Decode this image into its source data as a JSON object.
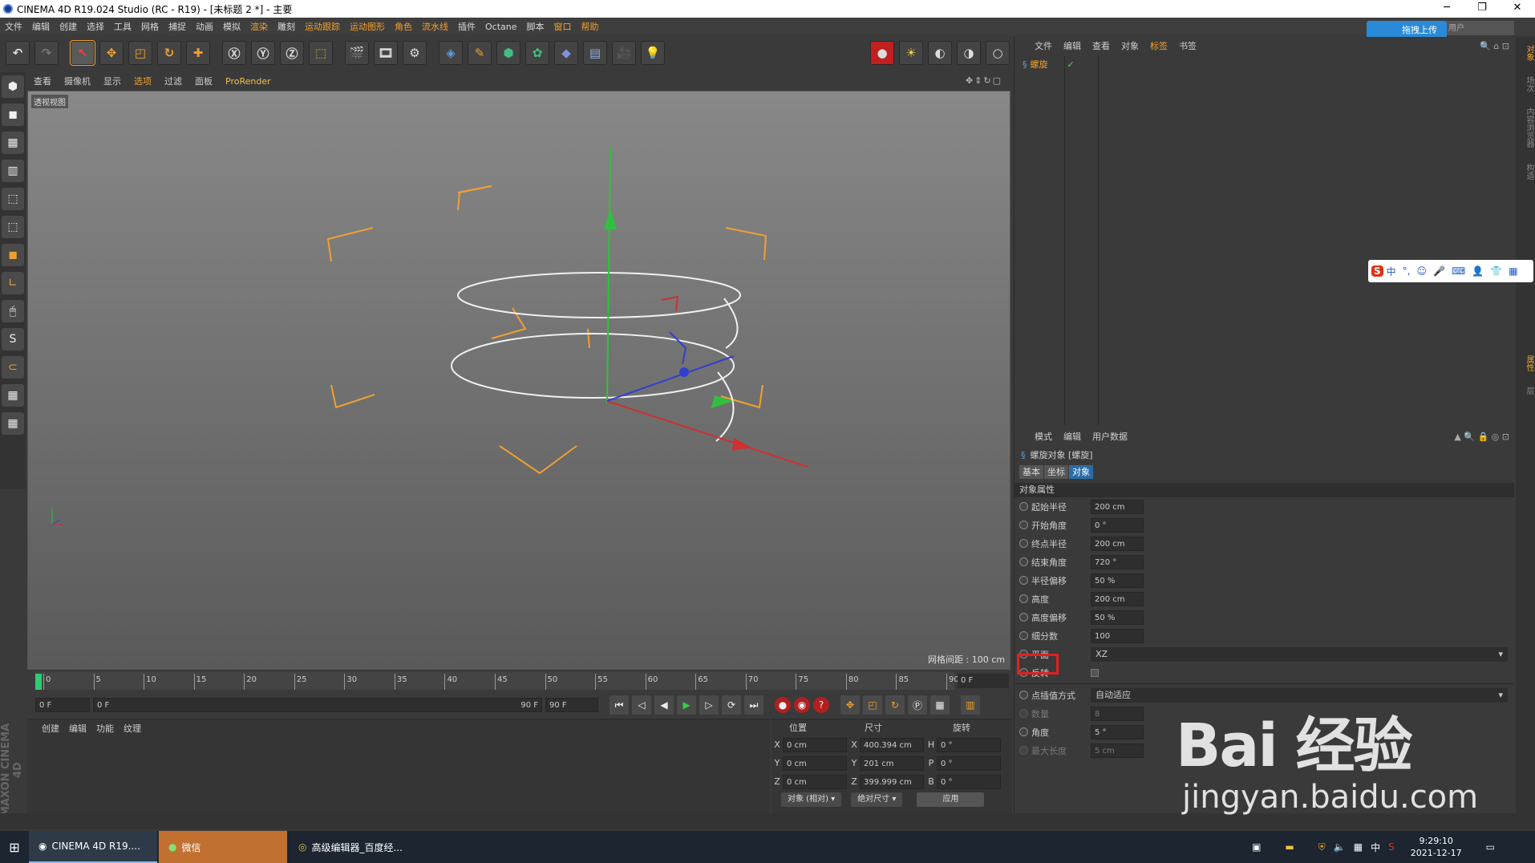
{
  "window": {
    "title": "CINEMA 4D R19.024 Studio (RC - R19) - [未标题 2 *] - 主要"
  },
  "menu": [
    "文件",
    "编辑",
    "创建",
    "选择",
    "工具",
    "网格",
    "捕捉",
    "动画",
    "模拟",
    "渲染",
    "雕刻",
    "运动跟踪",
    "运动图形",
    "角色",
    "流水线",
    "插件",
    "Octane",
    "脚本",
    "窗口",
    "帮助"
  ],
  "upload": "拖拽上传",
  "user": "用户",
  "viewport": {
    "menu": [
      "查看",
      "摄像机",
      "显示",
      "选项",
      "过滤",
      "面板",
      "ProRender"
    ],
    "label": "透视视图",
    "grid": "网格间距 : 100 cm"
  },
  "timeline": {
    "ticks": [
      "0",
      "5",
      "10",
      "15",
      "20",
      "25",
      "30",
      "35",
      "40",
      "45",
      "50",
      "55",
      "60",
      "65",
      "70",
      "75",
      "80",
      "85",
      "90"
    ],
    "frame": "0 F"
  },
  "playback": {
    "start": "0 F",
    "range_start": "0 F",
    "range_end": "90 F",
    "end": "90 F"
  },
  "materials": {
    "menu": [
      "创建",
      "编辑",
      "功能",
      "纹理"
    ]
  },
  "coords": {
    "headers": [
      "位置",
      "尺寸",
      "旋转"
    ],
    "rows": [
      {
        "axis": "X",
        "pos": "0 cm",
        "size_axis": "X",
        "size": "400.394 cm",
        "rot_axis": "H",
        "rot": "0 °"
      },
      {
        "axis": "Y",
        "pos": "0 cm",
        "size_axis": "Y",
        "size": "201 cm",
        "rot_axis": "P",
        "rot": "0 °"
      },
      {
        "axis": "Z",
        "pos": "0 cm",
        "size_axis": "Z",
        "size": "399.999 cm",
        "rot_axis": "B",
        "rot": "0 °"
      }
    ],
    "mode": "对象 (相对)",
    "sizemode": "绝对尺寸",
    "apply": "应用"
  },
  "objects": {
    "menu": [
      "文件",
      "编辑",
      "查看",
      "对象",
      "标签",
      "书签"
    ],
    "item": "螺旋"
  },
  "attributes": {
    "menu": [
      "模式",
      "编辑",
      "用户数据"
    ],
    "title": "螺旋对象 [螺旋]",
    "tabs": [
      "基本",
      "坐标",
      "对象"
    ],
    "section": "对象属性",
    "params": [
      {
        "name": "起始半径",
        "value": "200 cm"
      },
      {
        "name": "开始角度",
        "value": "0 °"
      },
      {
        "name": "终点半径",
        "value": "200 cm"
      },
      {
        "name": "结束角度",
        "value": "720 °"
      },
      {
        "name": "半径偏移",
        "value": "50 %"
      },
      {
        "name": "高度",
        "value": "200 cm"
      },
      {
        "name": "高度偏移",
        "value": "50 %"
      },
      {
        "name": "细分数",
        "value": "100"
      }
    ],
    "plane": {
      "name": "平面",
      "value": "XZ"
    },
    "reverse": {
      "name": "反转"
    },
    "interp": {
      "name": "点插值方式",
      "value": "自动适应"
    },
    "dim_params": [
      {
        "name": "数量",
        "value": "8"
      },
      {
        "name": "角度",
        "value": "5 °"
      },
      {
        "name": "最大长度",
        "value": "5 cm"
      }
    ]
  },
  "right_strip": [
    "对象",
    "场次",
    "内容浏览器",
    "构造"
  ],
  "right_strip2": [
    "属性",
    "层"
  ],
  "ime": {
    "items": [
      "中",
      "°,",
      "☺",
      "🎤",
      "⌨",
      "👤",
      "👕",
      "▦"
    ]
  },
  "watermark": {
    "main": "Bai 经验",
    "sub": "jingyan.baidu.com"
  },
  "taskbar": {
    "items": [
      "CINEMA 4D R19....",
      "微信",
      "高级编辑器_百度经..."
    ],
    "time": "9:29:10",
    "date": "2021-12-17",
    "ime": "中"
  }
}
